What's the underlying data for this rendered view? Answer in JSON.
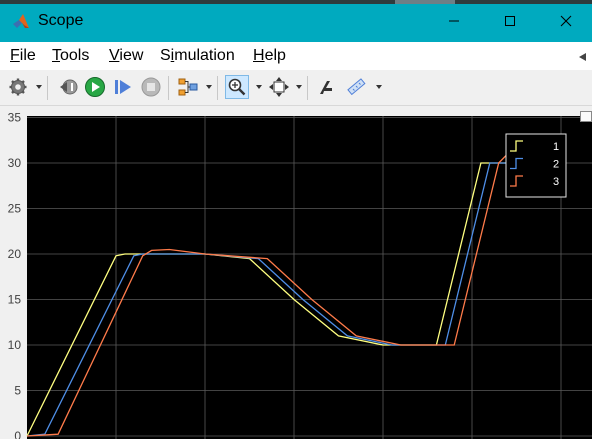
{
  "window": {
    "title": "Scope"
  },
  "menu": {
    "items": [
      "File",
      "Tools",
      "View",
      "Simulation",
      "Help"
    ],
    "underline_letters": [
      "F",
      "T",
      "V",
      "i",
      "H"
    ]
  },
  "toolbar": {
    "buttons": [
      "settings-icon",
      "step-back-icon",
      "run-icon",
      "step-forward-icon",
      "stop-icon",
      "signal-select-icon",
      "zoom-in-icon",
      "fit-to-view-icon",
      "style-icon",
      "measure-icon"
    ],
    "active": "zoom-in-icon"
  },
  "colors": {
    "titlebar": "#00aabf",
    "plot_background": "#000000",
    "grid": "#5a5a5a",
    "series1": "#ffff80",
    "series2": "#4f8fe8",
    "series3": "#ff7b4a",
    "run": "#28a745"
  },
  "chart_data": {
    "type": "line",
    "title": "",
    "xlabel": "",
    "ylabel": "",
    "ylim": [
      0,
      35
    ],
    "yticks": [
      "0",
      "5",
      "10",
      "15",
      "20",
      "25",
      "30",
      "35"
    ],
    "grid": true,
    "legend_position": "top-right",
    "series": [
      {
        "name": "1",
        "x": [
          0,
          1.0,
          1.1,
          2.0,
          2.5,
          3.0,
          3.5,
          4.0,
          4.35,
          4.6,
          5.1,
          5.5,
          6.0
        ],
        "y": [
          0,
          19.8,
          20,
          20,
          19.5,
          15,
          11,
          10,
          10,
          10,
          30,
          30,
          30
        ]
      },
      {
        "name": "2",
        "x": [
          0,
          0.2,
          1.2,
          1.3,
          2.0,
          2.6,
          3.1,
          3.6,
          4.1,
          4.45,
          4.7,
          5.2,
          5.6,
          6.0
        ],
        "y": [
          0,
          0.2,
          19.8,
          20,
          20,
          19.5,
          15,
          11,
          10,
          10,
          10,
          30,
          30,
          30
        ]
      },
      {
        "name": "3",
        "x": [
          0,
          0.35,
          1.3,
          1.4,
          1.6,
          2.0,
          2.7,
          3.2,
          3.7,
          4.2,
          4.55,
          4.8,
          5.3,
          5.4,
          5.7,
          6.0
        ],
        "y": [
          0,
          0.2,
          19.8,
          20.4,
          20.5,
          20,
          19.5,
          15,
          11,
          10,
          10,
          10,
          30,
          31,
          30,
          30
        ]
      }
    ]
  }
}
